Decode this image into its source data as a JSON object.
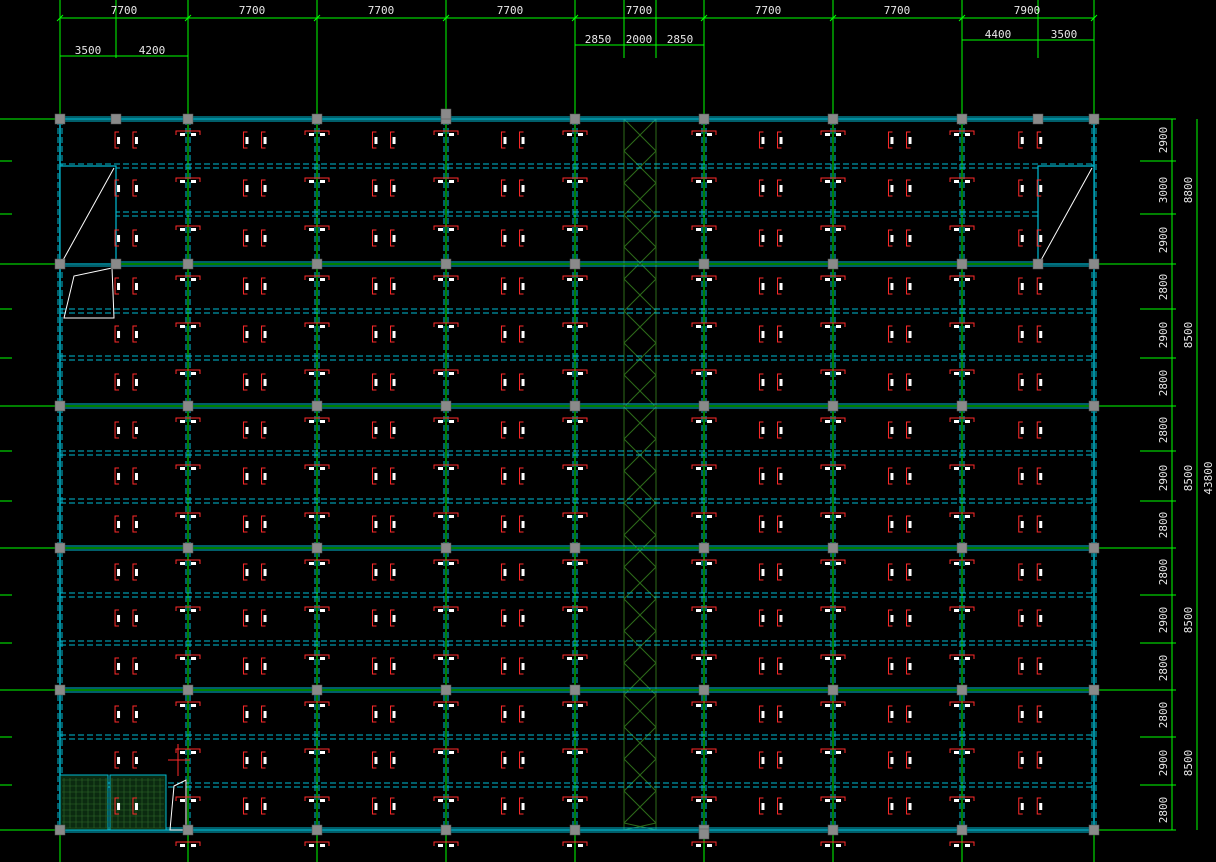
{
  "top_dims": {
    "bays": [
      "7700",
      "7700",
      "7700",
      "7700",
      "7700",
      "7700",
      "7700",
      "7900"
    ],
    "left_sub": [
      "3500",
      "4200"
    ],
    "mid_sub": [
      "2850",
      "2000",
      "2850"
    ],
    "right_sub": [
      "4400",
      "3500"
    ]
  },
  "right_dims": {
    "sub": [
      "2900",
      "3000",
      "2900",
      "2800",
      "2900",
      "2800",
      "2800",
      "2900",
      "2800",
      "2800",
      "2900",
      "2800",
      "2800",
      "2900",
      "2800"
    ],
    "bays": [
      "8800",
      "8500",
      "8500",
      "8500",
      "8500"
    ],
    "total": "43800"
  },
  "colors": {
    "background": "#000000",
    "grid_axis": "#00ff00",
    "beam": "#00bcd4",
    "column": "#8a8a8a",
    "rebar": "#ff2a2a",
    "label": "#ffffff",
    "hatch": "#2e6b1a"
  }
}
